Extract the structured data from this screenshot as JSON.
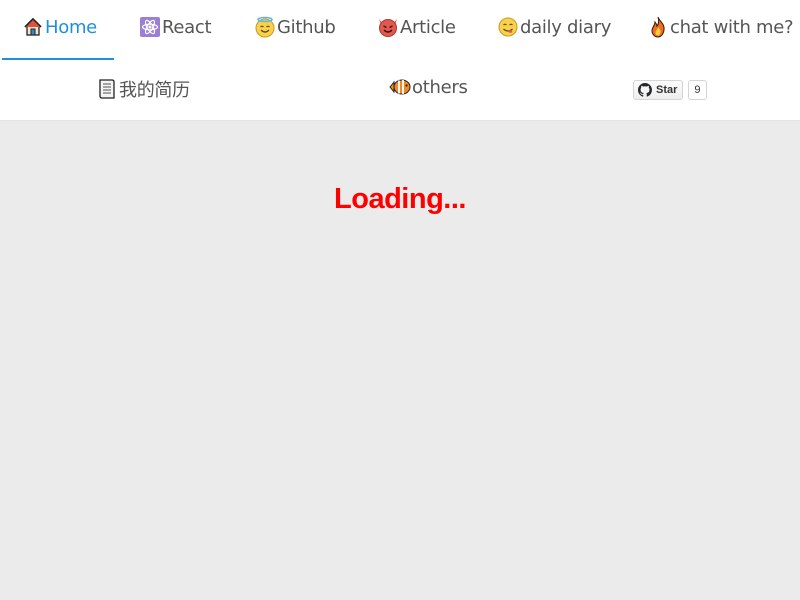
{
  "nav": {
    "items": [
      {
        "label": "Home",
        "icon": "house-icon"
      },
      {
        "label": "React",
        "icon": "atom-icon"
      },
      {
        "label": "Github",
        "icon": "smiling-face-with-halo-icon"
      },
      {
        "label": "Article",
        "icon": "smiling-devil-icon"
      },
      {
        "label": "daily diary",
        "icon": "face-savoring-food-icon"
      },
      {
        "label": "chat with me?",
        "icon": "fire-icon"
      },
      {
        "label": "我的简历",
        "icon": "page-with-curl-icon"
      },
      {
        "label": "others",
        "icon": "tropical-fish-icon"
      }
    ],
    "active": "Home",
    "accent_color": "#1e8fde"
  },
  "github_star": {
    "label": "Star",
    "count": "9",
    "icon": "github-icon"
  },
  "main": {
    "status_text": "Loading...",
    "status_color": "#ff0000",
    "background": "#ebebeb"
  }
}
